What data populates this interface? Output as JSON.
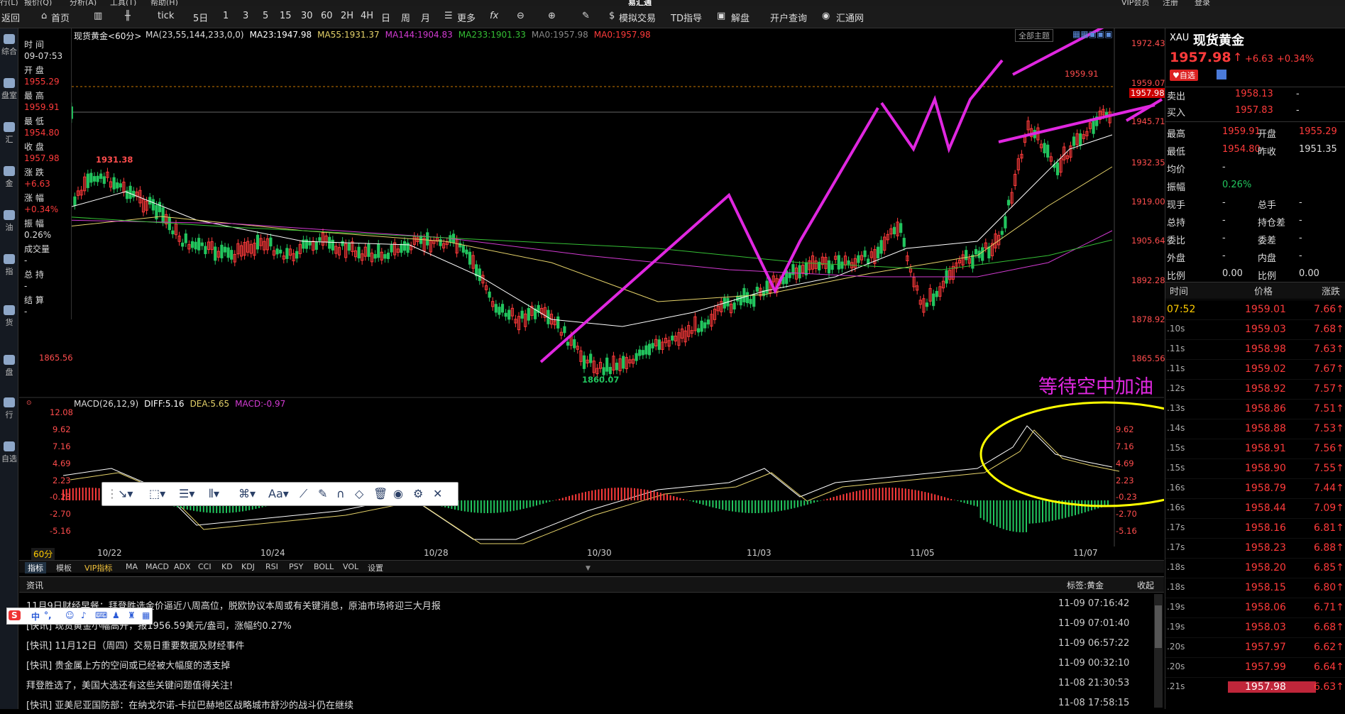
{
  "menu": [
    "行(L)",
    "报价(Q)",
    "分析(A)",
    "工具(T)",
    "帮助(H)",
    "易汇通",
    "VIP会员",
    "注册",
    "登录"
  ],
  "toolbar": {
    "items": [
      "返回",
      "首页",
      "tick",
      "5日",
      "1",
      "3",
      "5",
      "15",
      "30",
      "60",
      "2H",
      "4H",
      "日",
      "周",
      "月",
      "更多",
      "模拟交易",
      "TD指导",
      "解盘",
      "开户查询",
      "汇通网"
    ]
  },
  "sidebar": [
    "综合",
    "盘室",
    "汇",
    "金",
    "油",
    "指",
    "货",
    "盘",
    "行",
    "自选"
  ],
  "chart": {
    "symbol": "现货黄金",
    "period": "<60分>",
    "legend": [
      {
        "text": "MA(23,55,144,233,0,0)",
        "color": "#dddddd"
      },
      {
        "text": "MA23:1947.98",
        "color": "#ffffff"
      },
      {
        "text": "MA55:1931.37",
        "color": "#e6d36a"
      },
      {
        "text": "MA144:1904.83",
        "color": "#d23bd2"
      },
      {
        "text": "MA233:1901.33",
        "color": "#35c035"
      },
      {
        "text": "MA0:1957.98",
        "color": "#888888"
      },
      {
        "text": "MA0:1957.98",
        "color": "#ff3b3b"
      }
    ],
    "theme_btn": "全部主题",
    "price_axis": [
      "1972.43",
      "1959.07",
      "1957.98",
      "1945.71",
      "1932.35",
      "1919.00",
      "1905.64",
      "1892.28",
      "1878.92",
      "1865.56"
    ],
    "left_axis": [
      "1865.56"
    ],
    "annotations": {
      "high": "1931.38",
      "low": "1860.07",
      "peak": "1959.91"
    },
    "caption": "等待空中加油",
    "macd_legend": [
      {
        "text": "MACD(26,12,9)",
        "color": "#dddddd"
      },
      {
        "text": "DIFF:5.16",
        "color": "#ffffff"
      },
      {
        "text": "DEA:5.65",
        "color": "#e6d36a"
      },
      {
        "text": "MACD:-0.97",
        "color": "#d23bd2"
      }
    ],
    "macd_axis": [
      "12.08",
      "9.62",
      "7.16",
      "4.69",
      "2.23",
      "-0.23",
      "-2.70",
      "-5.16"
    ],
    "dates": [
      "10/22",
      "10/24",
      "10/28",
      "10/30",
      "11/03",
      "11/05",
      "11/07"
    ],
    "period_label": "60分"
  },
  "info": {
    "time_label": "时 间",
    "time": "09-07:53",
    "open_label": "开 盘",
    "open": "1955.29",
    "high_label": "最 高",
    "high": "1959.91",
    "low_label": "最 低",
    "low": "1954.80",
    "close_label": "收 盘",
    "close": "1957.98",
    "chg_label": "涨 跌",
    "chg": "+6.63",
    "pct_label": "涨 幅",
    "pct": "+0.34%",
    "amp_label": "振 幅",
    "amp": "0.26%",
    "vol_label": "成交量",
    "vol": "-",
    "oi_label": "总 持",
    "oi": "-",
    "settle_label": "结 算",
    "settle": "-"
  },
  "bottom_tabs": [
    "指标",
    "模板",
    "VIP指标",
    "MA",
    "MACD",
    "ADX",
    "CCI",
    "KD",
    "KDJ",
    "RSI",
    "PSY",
    "BOLL",
    "VOL",
    "设置"
  ],
  "news": {
    "tab": "资讯",
    "tag": "标签:黄金",
    "collapse": "收起",
    "rows": [
      {
        "title": "11月9日财经早餐：拜登胜选金价逼近八周高位，脱欧协议本周或有关键消息，原油市场将迎三大月报",
        "time": "11-09 07:16:42"
      },
      {
        "title": "[快讯] 现货黄金小幅高开，报1956.59美元/盎司，涨幅约0.27%",
        "time": "11-09 07:01:40"
      },
      {
        "title": "[快讯] 11月12日（周四）交易日重要数据及财经事件",
        "time": "11-09 06:57:22"
      },
      {
        "title": "[快讯] 贵金属上方的空间或已经被大幅度的透支掉",
        "time": "11-09 00:32:10"
      },
      {
        "title": "拜登胜选了，美国大选还有这些关键问题值得关注!",
        "time": "11-08 21:30:53"
      },
      {
        "title": "[快讯] 亚美尼亚国防部：在纳戈尔诺-卡拉巴赫地区战略城市舒沙的战斗仍在继续",
        "time": "11-08 17:58:15"
      }
    ]
  },
  "quote": {
    "code": "XAU",
    "name": "现货黄金",
    "price": "1957.98",
    "chg": "+6.63",
    "pct": "+0.34%",
    "fav": "自选",
    "sell_label": "卖出",
    "sell": "1958.13",
    "sell_vol": "-",
    "buy_label": "买入",
    "buy": "1957.83",
    "buy_vol": "-",
    "rows": [
      {
        "l1": "最高",
        "v1": "1959.91",
        "l2": "开盘",
        "v2": "1955.29"
      },
      {
        "l1": "最低",
        "v1": "1954.80",
        "l2": "昨收",
        "v2": "1951.35"
      },
      {
        "l1": "均价",
        "v1": "-",
        "l2": "",
        "v2": ""
      },
      {
        "l1": "振幅",
        "v1": "0.26%",
        "l2": "",
        "v2": ""
      },
      {
        "l1": "现手",
        "v1": "-",
        "l2": "总手",
        "v2": "-"
      },
      {
        "l1": "总持",
        "v1": "-",
        "l2": "持仓差",
        "v2": "-"
      },
      {
        "l1": "委比",
        "v1": "-",
        "l2": "委差",
        "v2": "-"
      },
      {
        "l1": "外盘",
        "v1": "-",
        "l2": "内盘",
        "v2": "-"
      },
      {
        "l1": "比例",
        "v1": "0.00",
        "l2": "比例",
        "v2": "0.00"
      }
    ],
    "trades_head": [
      "时间",
      "价格",
      "涨跌"
    ],
    "trades": [
      {
        "t": "07:52",
        "p": "1959.01",
        "c": "7.66"
      },
      {
        "t": ".10s",
        "p": "1959.03",
        "c": "7.68"
      },
      {
        "t": ".11s",
        "p": "1958.98",
        "c": "7.63"
      },
      {
        "t": ".11s",
        "p": "1959.02",
        "c": "7.67"
      },
      {
        "t": ".12s",
        "p": "1958.92",
        "c": "7.57"
      },
      {
        "t": ".13s",
        "p": "1958.86",
        "c": "7.51"
      },
      {
        "t": ".14s",
        "p": "1958.88",
        "c": "7.53"
      },
      {
        "t": ".15s",
        "p": "1958.91",
        "c": "7.56"
      },
      {
        "t": ".15s",
        "p": "1958.90",
        "c": "7.55"
      },
      {
        "t": ".16s",
        "p": "1958.79",
        "c": "7.44"
      },
      {
        "t": ".16s",
        "p": "1958.44",
        "c": "7.09"
      },
      {
        "t": ".17s",
        "p": "1958.16",
        "c": "6.81"
      },
      {
        "t": ".17s",
        "p": "1958.23",
        "c": "6.88"
      },
      {
        "t": ".18s",
        "p": "1958.20",
        "c": "6.85"
      },
      {
        "t": ".18s",
        "p": "1958.15",
        "c": "6.80"
      },
      {
        "t": ".19s",
        "p": "1958.06",
        "c": "6.71"
      },
      {
        "t": ".19s",
        "p": "1958.03",
        "c": "6.68"
      },
      {
        "t": ".20s",
        "p": "1957.97",
        "c": "6.62"
      },
      {
        "t": ".20s",
        "p": "1957.99",
        "c": "6.64"
      },
      {
        "t": ".21s",
        "p": "1957.98",
        "c": "6.63"
      }
    ]
  },
  "ime": "中"
}
